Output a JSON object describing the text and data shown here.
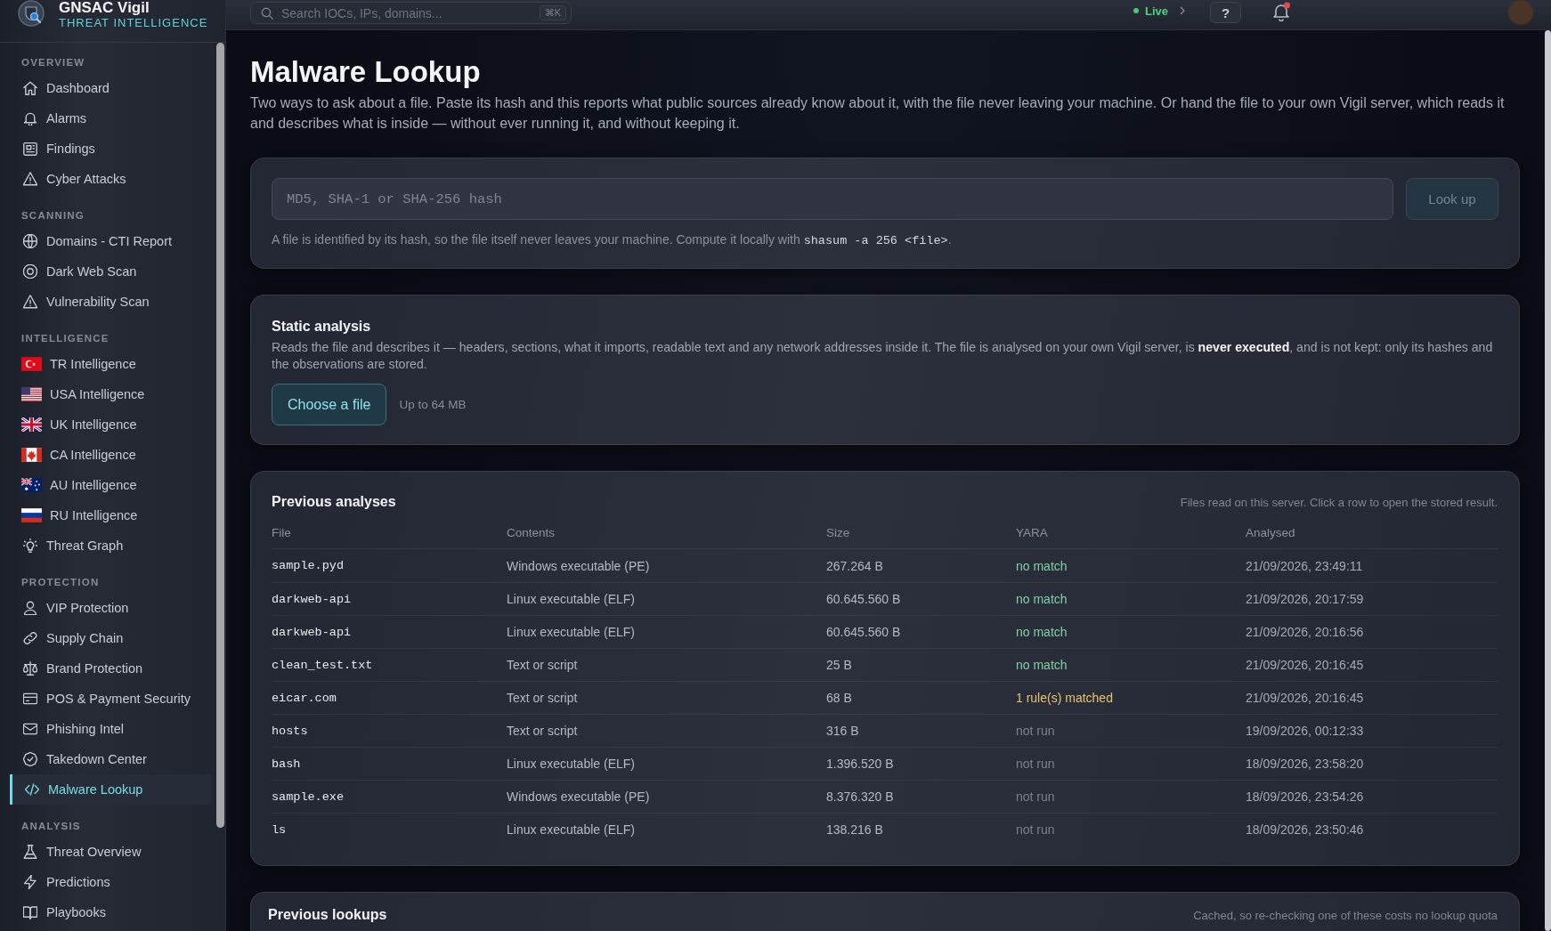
{
  "brand": {
    "title": "GNSAC Vigil",
    "subtitle": "THREAT INTELLIGENCE"
  },
  "sidebar": {
    "sections": [
      {
        "heading": "OVERVIEW",
        "items": [
          {
            "label": "Dashboard",
            "selected": false
          },
          {
            "label": "Alarms",
            "selected": false
          },
          {
            "label": "Findings",
            "selected": false
          },
          {
            "label": "Cyber Attacks",
            "selected": false
          }
        ]
      },
      {
        "heading": "SCANNING",
        "items": [
          {
            "label": "Domains - CTI Report",
            "selected": false
          },
          {
            "label": "Dark Web Scan",
            "selected": false
          },
          {
            "label": "Vulnerability Scan",
            "selected": false
          }
        ]
      },
      {
        "heading": "INTELLIGENCE",
        "items": [
          {
            "label": "TR Intelligence",
            "selected": false
          },
          {
            "label": "USA Intelligence",
            "selected": false
          },
          {
            "label": "UK Intelligence",
            "selected": false
          },
          {
            "label": "CA Intelligence",
            "selected": false
          },
          {
            "label": "AU Intelligence",
            "selected": false
          },
          {
            "label": "RU Intelligence",
            "selected": false
          },
          {
            "label": "Threat Graph",
            "selected": false
          }
        ]
      },
      {
        "heading": "PROTECTION",
        "items": [
          {
            "label": "VIP Protection",
            "selected": false
          },
          {
            "label": "Supply Chain",
            "selected": false
          },
          {
            "label": "Brand Protection",
            "selected": false
          },
          {
            "label": "POS & Payment Security",
            "selected": false
          },
          {
            "label": "Phishing Intel",
            "selected": false
          },
          {
            "label": "Takedown Center",
            "selected": false
          },
          {
            "label": "Malware Lookup",
            "selected": true
          }
        ]
      },
      {
        "heading": "ANALYSIS",
        "items": [
          {
            "label": "Threat Overview",
            "selected": false
          },
          {
            "label": "Predictions",
            "selected": false
          },
          {
            "label": "Playbooks",
            "selected": false
          }
        ]
      }
    ]
  },
  "topbar": {
    "search": {
      "placeholder": "Search IOCs, IPs, domains...",
      "shortcut": "⌘K"
    },
    "status": "Live",
    "help": "?"
  },
  "page": {
    "title": "Malware Lookup",
    "description": "Two ways to ask about a file. Paste its hash and this reports what public sources already know about it, with the file never leaving your machine. Or hand the file to your own Vigil server, which reads it and describes what is inside — without ever running it, and without keeping it."
  },
  "hash_lookup": {
    "placeholder": "MD5, SHA-1 or SHA-256 hash",
    "button": {
      "label": "Look up",
      "disabled": true
    },
    "hint": [
      {
        "kind": "text",
        "text": "A file is identified by its hash, so the file itself never leaves your machine. Compute it locally with "
      },
      {
        "kind": "code",
        "text": "shasum -a 256 <file>"
      },
      {
        "kind": "text",
        "text": "."
      }
    ]
  },
  "static_analysis": {
    "title": "Static analysis",
    "description": "Reads the file and describes it — headers, sections, what it imports, readable text and any network addresses inside it. The file is analysed on your own Vigil server, is **never executed**, and is not kept: only its hashes and the observations are stored.",
    "button": "Choose a file",
    "limit": "Up to 64 MB"
  },
  "previous_analyses": {
    "title": "Previous analyses",
    "note": "Files read on this server. Click a row to open the stored result.",
    "columns": [
      "File",
      "Contents",
      "Size",
      "YARA",
      "Analysed"
    ],
    "rows": [
      {
        "file": "sample.pyd",
        "contents": "Windows executable (PE)",
        "size": "267.264 B",
        "yara": {
          "text": "no match",
          "kind": "clean"
        },
        "analysed": "21/09/2026, 23:49:11"
      },
      {
        "file": "darkweb-api",
        "contents": "Linux executable (ELF)",
        "size": "60.645.560 B",
        "yara": {
          "text": "no match",
          "kind": "clean"
        },
        "analysed": "21/09/2026, 20:17:59"
      },
      {
        "file": "darkweb-api",
        "contents": "Linux executable (ELF)",
        "size": "60.645.560 B",
        "yara": {
          "text": "no match",
          "kind": "clean"
        },
        "analysed": "21/09/2026, 20:16:56"
      },
      {
        "file": "clean_test.txt",
        "contents": "Text or script",
        "size": "25 B",
        "yara": {
          "text": "no match",
          "kind": "clean"
        },
        "analysed": "21/09/2026, 20:16:45"
      },
      {
        "file": "eicar.com",
        "contents": "Text or script",
        "size": "68 B",
        "yara": {
          "text": "1 rule(s) matched",
          "kind": "match"
        },
        "analysed": "21/09/2026, 20:16:45"
      },
      {
        "file": "hosts",
        "contents": "Text or script",
        "size": "316 B",
        "yara": {
          "text": "not run",
          "kind": "not_run"
        },
        "analysed": "19/09/2026, 00:12:33"
      },
      {
        "file": "bash",
        "contents": "Linux executable (ELF)",
        "size": "1.396.520 B",
        "yara": {
          "text": "not run",
          "kind": "not_run"
        },
        "analysed": "18/09/2026, 23:58:20"
      },
      {
        "file": "sample.exe",
        "contents": "Windows executable (PE)",
        "size": "8.376.320 B",
        "yara": {
          "text": "not run",
          "kind": "not_run"
        },
        "analysed": "18/09/2026, 23:54:26"
      },
      {
        "file": "ls",
        "contents": "Linux executable (ELF)",
        "size": "138.216 B",
        "yara": {
          "text": "not run",
          "kind": "not_run"
        },
        "analysed": "18/09/2026, 23:50:46"
      }
    ]
  },
  "previous_lookups": {
    "title": "Previous lookups",
    "note": "Cached, so re-checking one of these costs no lookup quota"
  }
}
